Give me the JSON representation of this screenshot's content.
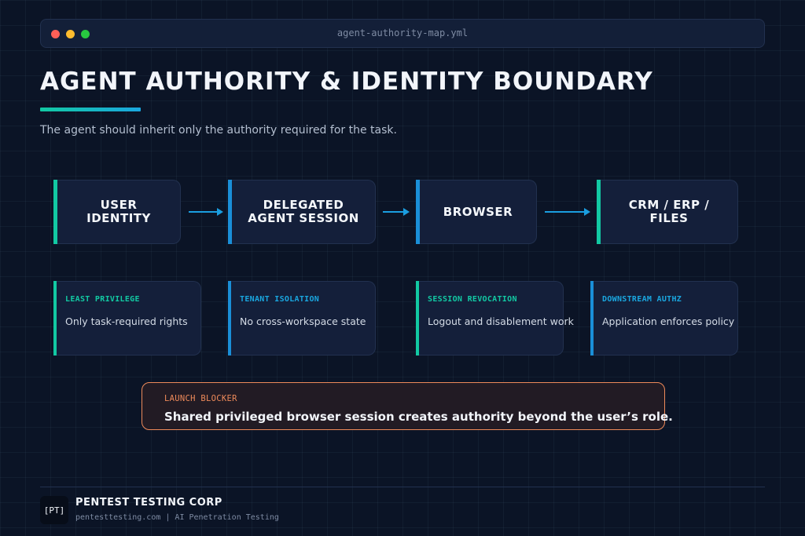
{
  "window": {
    "title": "agent-authority-map.yml"
  },
  "header": {
    "title": "AGENT AUTHORITY & IDENTITY BOUNDARY",
    "subtitle": "The agent should inherit only the authority required for the task."
  },
  "flow": {
    "nodes": [
      {
        "label": "USER\nIDENTITY"
      },
      {
        "label": "DELEGATED\nAGENT SESSION"
      },
      {
        "label": "BROWSER"
      },
      {
        "label": "CRM / ERP /\nFILES"
      }
    ]
  },
  "controls": [
    {
      "tag": "LEAST PRIVILEGE",
      "text": "Only task-required rights"
    },
    {
      "tag": "TENANT ISOLATION",
      "text": "No cross-workspace state"
    },
    {
      "tag": "SESSION REVOCATION",
      "text": "Logout and disablement work"
    },
    {
      "tag": "DOWNSTREAM AUTHZ",
      "text": "Application enforces policy"
    }
  ],
  "blocker": {
    "tag": "LAUNCH BLOCKER",
    "text": "Shared privileged browser session creates authority beyond the user’s role."
  },
  "footer": {
    "logo": "[PT]",
    "company": "PENTEST TESTING CORP",
    "sub": "pentesttesting.com | AI Penetration Testing"
  },
  "colors": {
    "background": "#0b1426",
    "accent_green": "#12c9a3",
    "accent_blue": "#1a8fd8",
    "warning": "#ee8a5a"
  }
}
